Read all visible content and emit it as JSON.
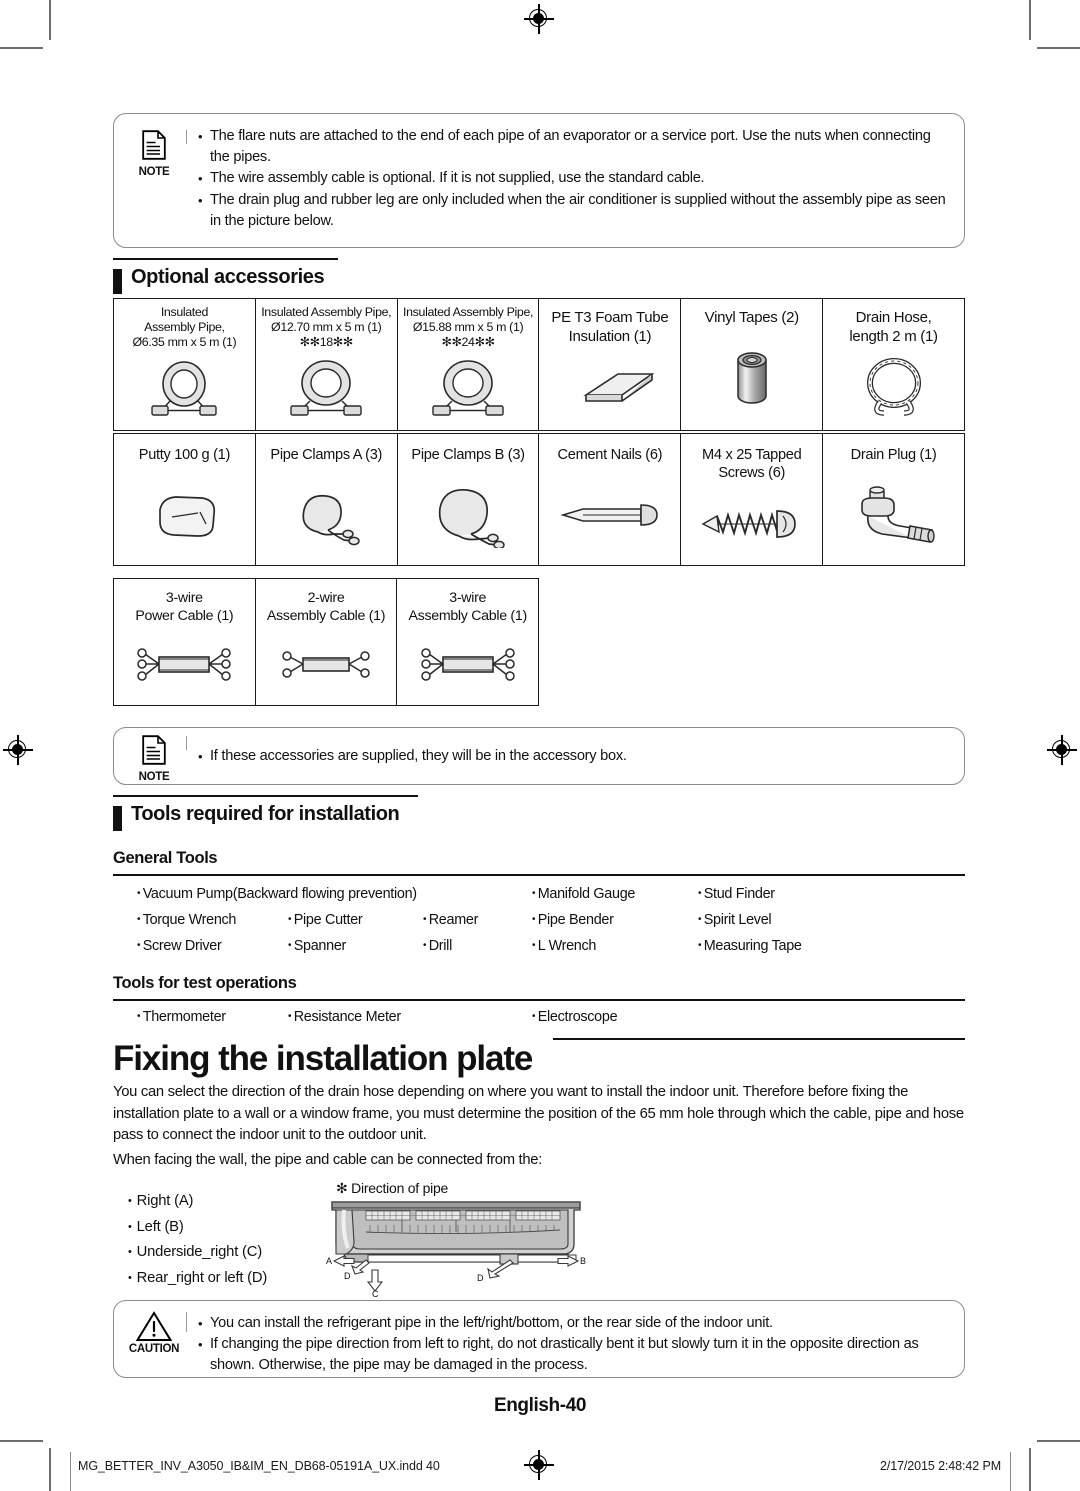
{
  "note_top": {
    "icon_label": "NOTE",
    "items": [
      "The flare nuts are attached to the end of each pipe of an evaporator or a service port. Use the nuts when connecting the pipes.",
      "The wire assembly cable is optional. If it is not supplied, use the standard cable.",
      "The drain plug and rubber leg are only included when the air conditioner is supplied without the assembly pipe as seen in the picture below."
    ]
  },
  "optional_accessories": {
    "heading": "Optional accessories",
    "rows": [
      [
        {
          "caption": "Insulated\nAssembly Pipe,\nØ6.35 mm x 5 m (1)",
          "art": "coil-pipe"
        },
        {
          "caption": "Insulated Assembly Pipe,\nØ12.70 mm x 5 m (1)\n✻✻18✻✻",
          "art": "coil-pipe"
        },
        {
          "caption": "Insulated Assembly Pipe,\nØ15.88 mm x 5 m (1)\n✻✻24✻✻",
          "art": "coil-pipe"
        },
        {
          "caption": "PE T3 Foam Tube\nInsulation (1)",
          "art": "foam-slab"
        },
        {
          "caption": "Vinyl Tapes (2)",
          "art": "tape-roll"
        },
        {
          "caption": "Drain Hose,\nlength 2 m (1)",
          "art": "drain-hose"
        }
      ],
      [
        {
          "caption": "Putty 100 g (1)",
          "art": "putty-block"
        },
        {
          "caption": "Pipe Clamps A (3)",
          "art": "clamp-a"
        },
        {
          "caption": "Pipe Clamps B (3)",
          "art": "clamp-b"
        },
        {
          "caption": "Cement Nails (6)",
          "art": "nail"
        },
        {
          "caption": "M4 x 25 Tapped\nScrews (6)",
          "art": "screw"
        },
        {
          "caption": "Drain Plug (1)",
          "art": "drain-plug"
        }
      ],
      [
        {
          "caption": "3-wire\nPower Cable (1)",
          "art": "cable-3"
        },
        {
          "caption": "2-wire\nAssembly Cable (1)",
          "art": "cable-2"
        },
        {
          "caption": "3-wire\nAssembly Cable (1)",
          "art": "cable-3"
        }
      ]
    ]
  },
  "note_bottom": {
    "icon_label": "NOTE",
    "items": [
      "If these accessories are supplied, they will be in the accessory box."
    ]
  },
  "tools_section": {
    "heading": "Tools required for installation",
    "general_tools_label": "General Tools",
    "general_tools": [
      [
        "Vacuum Pump(Backward flowing prevention)",
        "",
        "",
        "Manifold Gauge",
        "Stud Finder"
      ],
      [
        "Torque Wrench",
        "Pipe Cutter",
        "Reamer",
        "Pipe Bender",
        "Spirit Level"
      ],
      [
        "Screw Driver",
        "Spanner",
        "Drill",
        "L Wrench",
        "Measuring Tape"
      ]
    ],
    "test_tools_label": "Tools for test operations",
    "test_tools": [
      [
        "Thermometer",
        "Resistance Meter",
        "",
        "Electroscope",
        ""
      ]
    ]
  },
  "main": {
    "title": "Fixing the installation plate",
    "paragraph1": "You can select the direction of the drain hose depending on where you want to install the indoor unit. Therefore before fixing the installation plate to a wall or a window frame, you must determine the position of the 65 mm hole through which the cable, pipe and hose pass to connect the indoor unit to the outdoor unit.",
    "paragraph2": "When facing the wall, the pipe and cable can be connected from the:",
    "directions": [
      "Right (A)",
      "Left (B)",
      "Underside_right (C)",
      "Rear_right or left (D)"
    ],
    "diagram_caption": "✻ Direction of pipe",
    "diagram_labels": {
      "left": "A",
      "right": "B",
      "bottom": "C",
      "rear1": "D",
      "rear2": "D"
    }
  },
  "caution": {
    "icon_label": "CAUTION",
    "items": [
      "You can install the refrigerant pipe in the left/right/bottom, or the rear side of the indoor unit.",
      "If changing the pipe direction from left to right, do not drastically bent it but slowly turn it in the opposite direction as shown. Otherwise, the pipe may be damaged in the process."
    ]
  },
  "page_number": "English-40",
  "footer": {
    "file": "MG_BETTER_INV_A3050_IB&IM_EN_DB68-05191A_UX.indd   40",
    "timestamp": "2/17/2015   2:48:42 PM"
  }
}
